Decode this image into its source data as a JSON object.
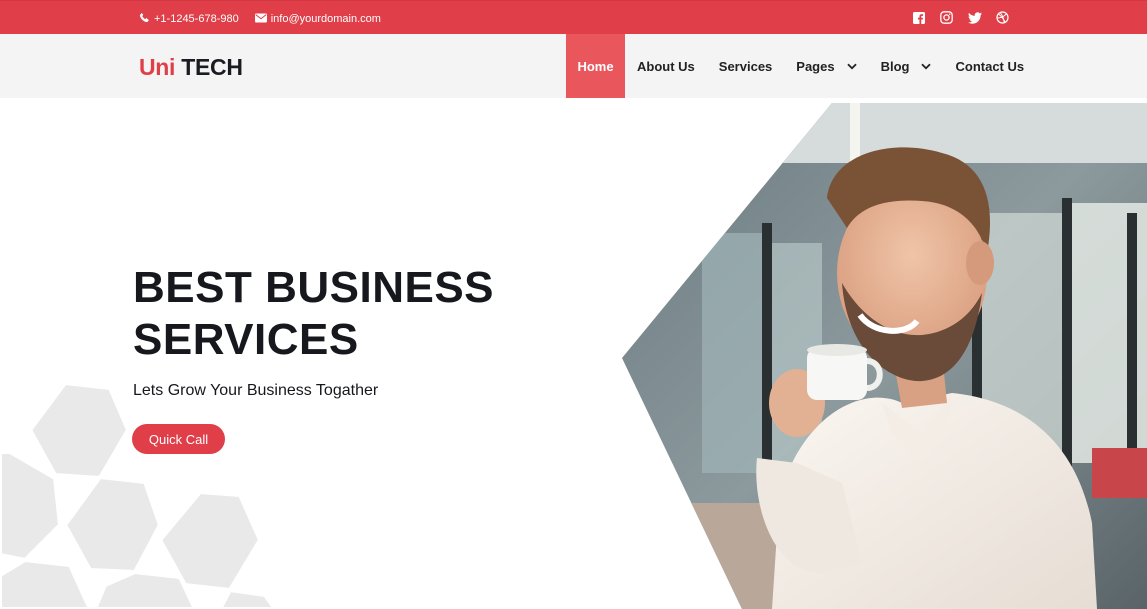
{
  "topbar": {
    "phone": "+1-1245-678-980",
    "email": "info@yourdomain.com",
    "social_icons": [
      "facebook-icon",
      "instagram-icon",
      "twitter-icon",
      "dribbble-icon"
    ]
  },
  "brand": {
    "part1": "Uni",
    "part2": "TECH"
  },
  "nav": {
    "items": [
      {
        "label": "Home",
        "active": true
      },
      {
        "label": "About Us"
      },
      {
        "label": "Services"
      },
      {
        "label": "Pages",
        "dropdown": true
      },
      {
        "label": "Blog",
        "dropdown": true
      },
      {
        "label": "Contact Us"
      }
    ]
  },
  "hero": {
    "title_line1": "BEST BUSINESS",
    "title_line2": "SERVICES",
    "subtitle": "Lets Grow Your Business Togather",
    "cta": "Quick Call"
  },
  "colors": {
    "accent": "#e03e48",
    "active_nav": "#e9575d",
    "nav_bg": "#f4f4f4",
    "text_dark": "#16181d"
  }
}
